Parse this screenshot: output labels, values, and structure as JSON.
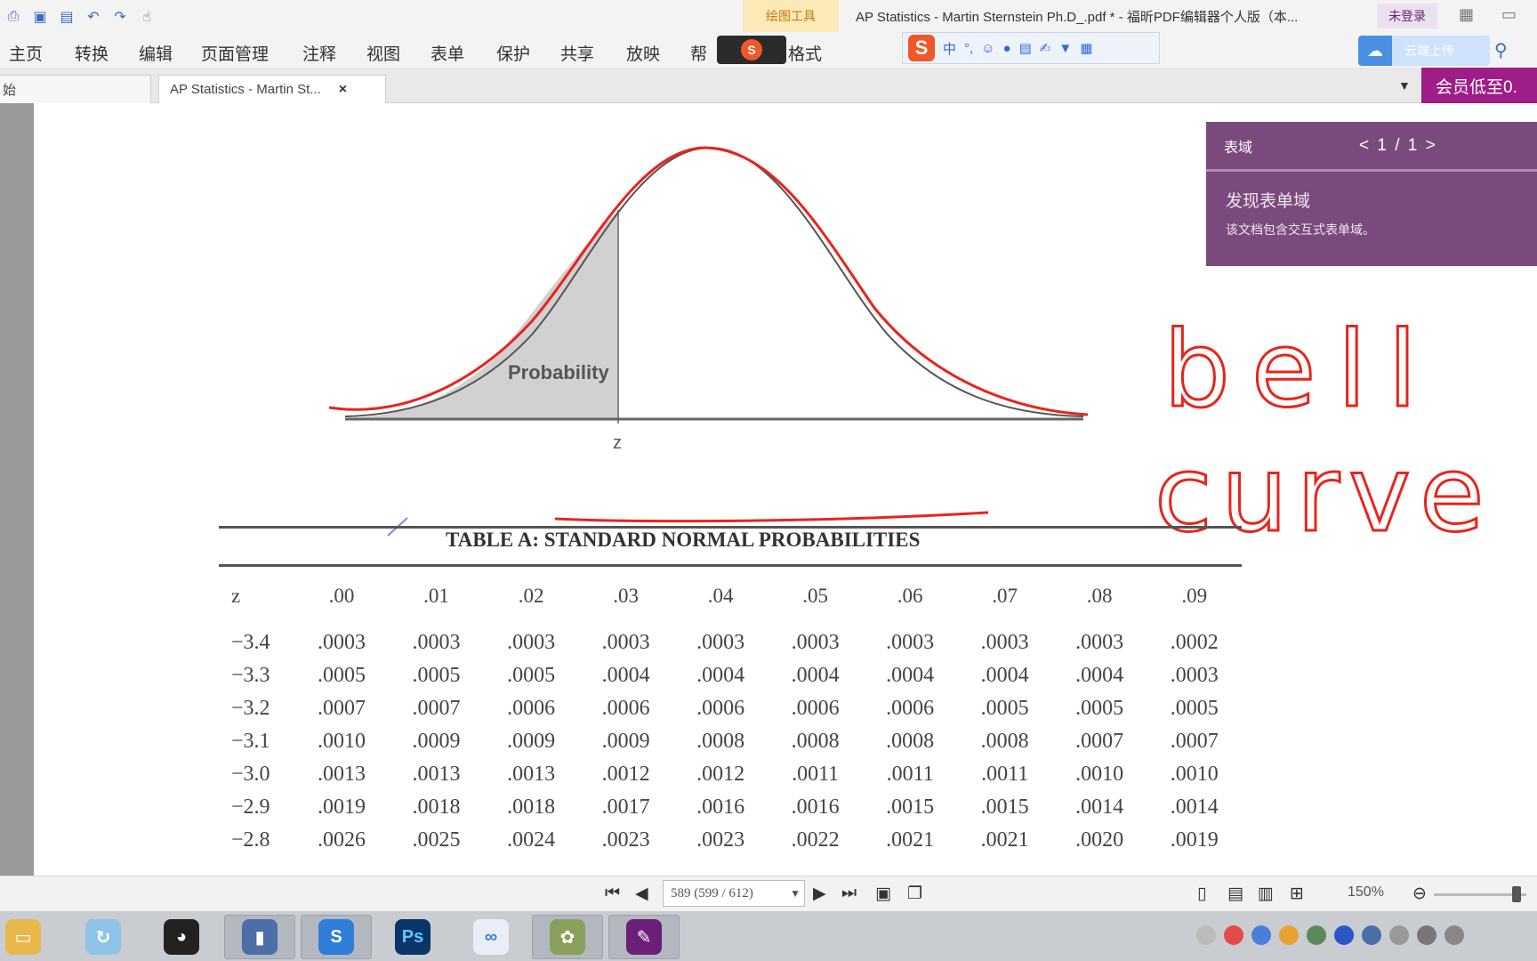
{
  "window": {
    "title": "AP Statistics - Martin Sternstein Ph.D_.pdf * - 福昕PDF编辑器个人版（本...",
    "context_tab": "绘图工具",
    "login_label": "未登录"
  },
  "menu": {
    "items": [
      "主页",
      "转换",
      "编辑",
      "页面管理",
      "注释",
      "视图",
      "表单",
      "保护",
      "共享",
      "放映",
      "帮",
      "格式"
    ]
  },
  "ime": {
    "logo": "S",
    "mode": "中"
  },
  "cloud_upload": {
    "label": "云端上传"
  },
  "tabs": {
    "partial_label": "始",
    "doc_label": "AP Statistics - Martin St...",
    "close": "×"
  },
  "vip": {
    "label": "会员低至0."
  },
  "figure": {
    "probability_label": "Probability",
    "z_label": "z"
  },
  "table": {
    "title": "TABLE A: STANDARD NORMAL PROBABILITIES",
    "headers": [
      "z",
      ".00",
      ".01",
      ".02",
      ".03",
      ".04",
      ".05",
      ".06",
      ".07",
      ".08",
      ".09"
    ],
    "rows": [
      [
        "−3.4",
        ".0003",
        ".0003",
        ".0003",
        ".0003",
        ".0003",
        ".0003",
        ".0003",
        ".0003",
        ".0003",
        ".0002"
      ],
      [
        "−3.3",
        ".0005",
        ".0005",
        ".0005",
        ".0004",
        ".0004",
        ".0004",
        ".0004",
        ".0004",
        ".0004",
        ".0003"
      ],
      [
        "−3.2",
        ".0007",
        ".0007",
        ".0006",
        ".0006",
        ".0006",
        ".0006",
        ".0006",
        ".0005",
        ".0005",
        ".0005"
      ],
      [
        "−3.1",
        ".0010",
        ".0009",
        ".0009",
        ".0009",
        ".0008",
        ".0008",
        ".0008",
        ".0008",
        ".0007",
        ".0007"
      ],
      [
        "−3.0",
        ".0013",
        ".0013",
        ".0013",
        ".0012",
        ".0012",
        ".0011",
        ".0011",
        ".0011",
        ".0010",
        ".0010"
      ],
      [
        "−2.9",
        ".0019",
        ".0018",
        ".0018",
        ".0017",
        ".0016",
        ".0016",
        ".0015",
        ".0015",
        ".0014",
        ".0014"
      ],
      [
        "−2.8",
        ".0026",
        ".0025",
        ".0024",
        ".0023",
        ".0023",
        ".0022",
        ".0021",
        ".0021",
        ".0020",
        ".0019"
      ]
    ]
  },
  "handwriting": {
    "line1": "bell",
    "line2": "curve",
    "color": "#e8241c"
  },
  "side_panel": {
    "title": "表域",
    "pager": "< 1 / 1 >",
    "text1": "发现表单域",
    "text2": "该文档包含交互式表单域。"
  },
  "status": {
    "page_indicator": "589 (599 / 612)",
    "zoom": "150%"
  },
  "colors": {
    "accent_purple": "#7b4a7d",
    "vip_magenta": "#9e1d86",
    "ink_red": "#e8241c"
  }
}
